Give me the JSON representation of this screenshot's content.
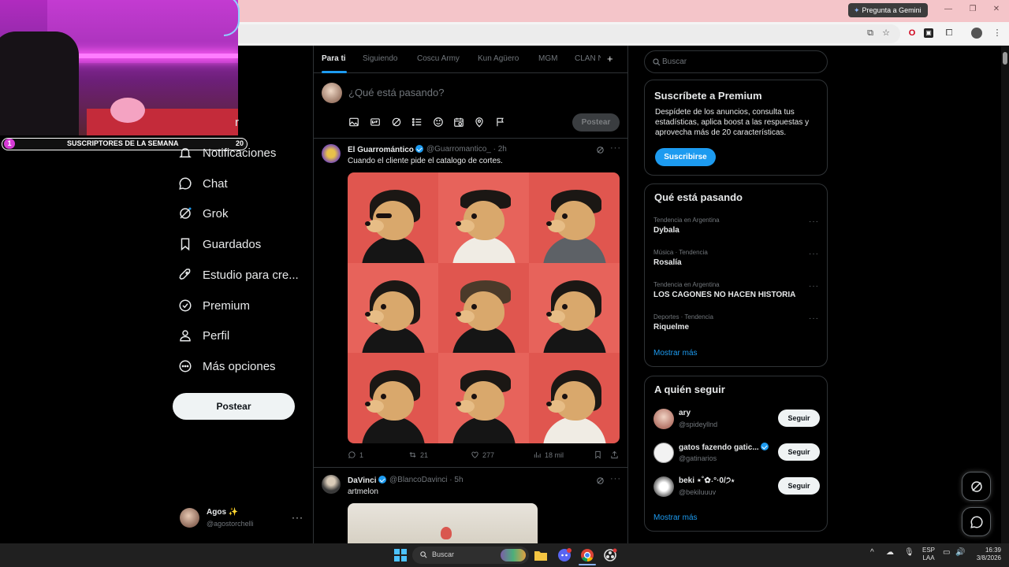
{
  "browser": {
    "gemini_button": "Pregunta a Gemini"
  },
  "stream_overlay": {
    "subs_title": "SUSCRIPTORES DE LA SEMANA",
    "subs_current": "1",
    "subs_goal": "20"
  },
  "left_nav": {
    "partial_label": "r",
    "items": [
      {
        "label": "Notificaciones"
      },
      {
        "label": "Chat"
      },
      {
        "label": "Grok"
      },
      {
        "label": "Guardados"
      },
      {
        "label": "Estudio para cre..."
      },
      {
        "label": "Premium"
      },
      {
        "label": "Perfil"
      },
      {
        "label": "Más opciones"
      }
    ],
    "post_button": "Postear",
    "account": {
      "name": "Agos ✨",
      "handle": "@agostorchelli"
    }
  },
  "tabs": [
    "Para ti",
    "Siguiendo",
    "Coscu Army",
    "Kun Agüero",
    "MGM",
    "CLAN N"
  ],
  "composer": {
    "placeholder": "¿Qué está pasando?",
    "post_button": "Postear"
  },
  "tweets": [
    {
      "name": "El Guarromántico",
      "handle": "@Guarromantico_",
      "time": "2h",
      "text": "Cuando el cliente pide el catalogo de cortes.",
      "replies": "1",
      "reposts": "21",
      "likes": "277",
      "views": "18 mil"
    },
    {
      "name": "DaVinci",
      "handle": "@BlancoDavinci",
      "time": "5h",
      "text": "artmelon"
    }
  ],
  "search": {
    "placeholder": "Buscar"
  },
  "premium_card": {
    "title": "Suscríbete a Premium",
    "text": "Despídete de los anuncios, consulta tus estadísticas, aplica boost a las respuestas y aprovecha más de 20 características.",
    "button": "Suscribirse"
  },
  "trends": {
    "title": "Qué está pasando",
    "items": [
      {
        "category": "Tendencia en Argentina",
        "name": "Dybala"
      },
      {
        "category": "Música · Tendencia",
        "name": "Rosalía"
      },
      {
        "category": "Tendencia en Argentina",
        "name": "LOS CAGONES NO HACEN HISTORIA"
      },
      {
        "category": "Deportes · Tendencia",
        "name": "Riquelme"
      }
    ],
    "show_more": "Mostrar más"
  },
  "who_to_follow": {
    "title": "A quién seguir",
    "items": [
      {
        "name": "ary",
        "handle": "@spideyllnd",
        "button": "Seguir"
      },
      {
        "name": "gatos fazendo gatic...",
        "handle": "@gatinarios",
        "button": "Seguir"
      },
      {
        "name": "beki ⋆˚✿˖°·0/੭⋆",
        "handle": "@bekiluuuv",
        "button": "Seguir"
      }
    ],
    "show_more": "Mostrar más"
  },
  "taskbar": {
    "search": "Buscar",
    "lang_top": "ESP",
    "lang_bottom": "LAA",
    "time": "16:39",
    "date": "3/8/2026"
  },
  "colors": {
    "accent": "#1d9bf0",
    "background": "#000000",
    "border": "#2f3336",
    "muted": "#71767b"
  }
}
